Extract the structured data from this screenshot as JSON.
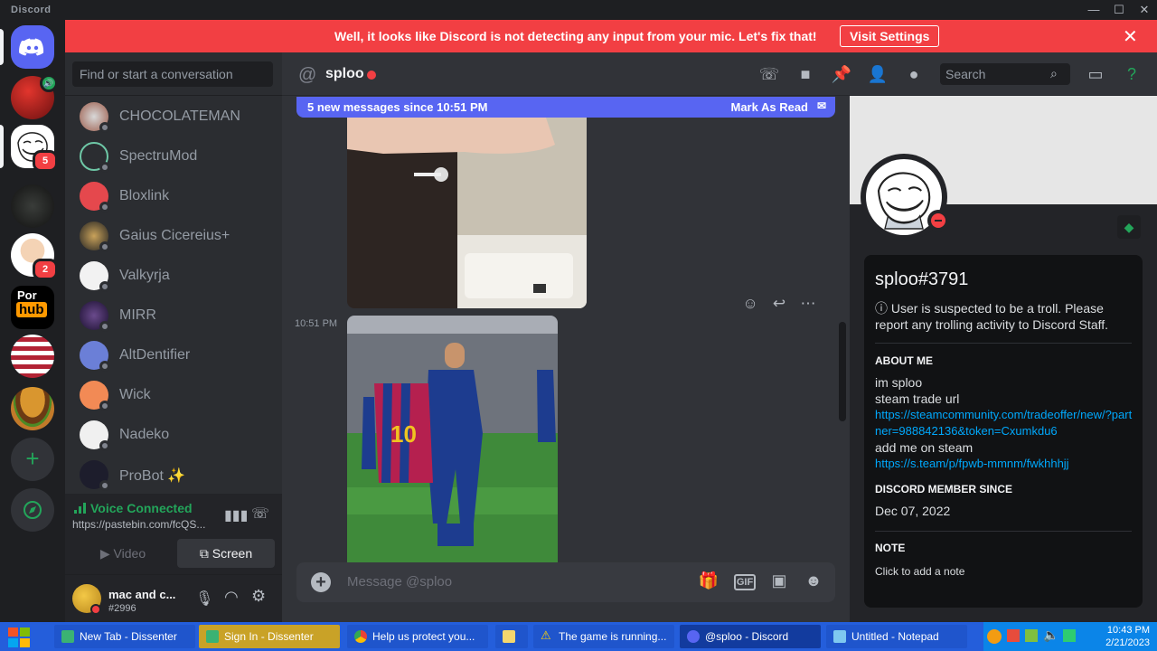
{
  "window": {
    "title": "Discord",
    "minimize": "—",
    "maximize": "☐",
    "close": "✕"
  },
  "notice": {
    "message": "Well, it looks like Discord is not detecting any input from your mic. Let's fix that!",
    "button": "Visit Settings",
    "close": "✕"
  },
  "rail": {
    "badges": {
      "troll": "5",
      "peter": "2"
    },
    "pornhub_text_top": "Por",
    "pornhub_text_bottom": "hub"
  },
  "dms": {
    "search_placeholder": "Find or start a conversation",
    "items": [
      {
        "name": "CHOCOLATEMAN"
      },
      {
        "name": "SpectruMod"
      },
      {
        "name": "Bloxlink"
      },
      {
        "name": "Gaius Cicereius+"
      },
      {
        "name": "Valkyrja"
      },
      {
        "name": "MIRR"
      },
      {
        "name": "AltDentifier"
      },
      {
        "name": "Wick"
      },
      {
        "name": "Nadeko"
      },
      {
        "name": "ProBot ✨"
      }
    ]
  },
  "voice": {
    "status": "Voice Connected",
    "channel": "https://pastebin.com/fcQS...",
    "video": "Video",
    "screen": "Screen"
  },
  "user": {
    "name": "mac and c...",
    "tag": "#2996"
  },
  "chat": {
    "channel_name": "sploo",
    "search_placeholder": "Search",
    "new_messages": "5 new messages since 10:51 PM",
    "mark_as_read": "Mark As Read",
    "timestamp": "10:51 PM",
    "composer_placeholder": "Message @sploo",
    "gif_label": "GIF",
    "jersey_number": "10"
  },
  "profile": {
    "username": "sploo#3791",
    "warning": "User is suspected to be a troll. Please report any trolling activity to Discord Staff.",
    "about_heading": "ABOUT ME",
    "about_line1": "im sploo",
    "about_line2": "steam trade url",
    "trade_link": "https://steamcommunity.com/tradeoffer/new/?partner=988842136&token=Cxumkdu6",
    "about_line3": "add me on steam",
    "steam_link": "https://s.team/p/fpwb-mmnm/fwkhhhjj",
    "member_since_heading": "DISCORD MEMBER SINCE",
    "member_since": "Dec 07, 2022",
    "note_heading": "NOTE",
    "note_placeholder": "Click to add a note"
  },
  "taskbar": {
    "items": [
      {
        "label": "New Tab - Dissenter"
      },
      {
        "label": "Sign In - Dissenter"
      },
      {
        "label": "Help us protect you..."
      },
      {
        "label": ""
      },
      {
        "label": "The game is running..."
      },
      {
        "label": "@sploo - Discord"
      },
      {
        "label": "Untitled - Notepad"
      }
    ],
    "time": "10:43 PM",
    "date": "2/21/2023"
  }
}
